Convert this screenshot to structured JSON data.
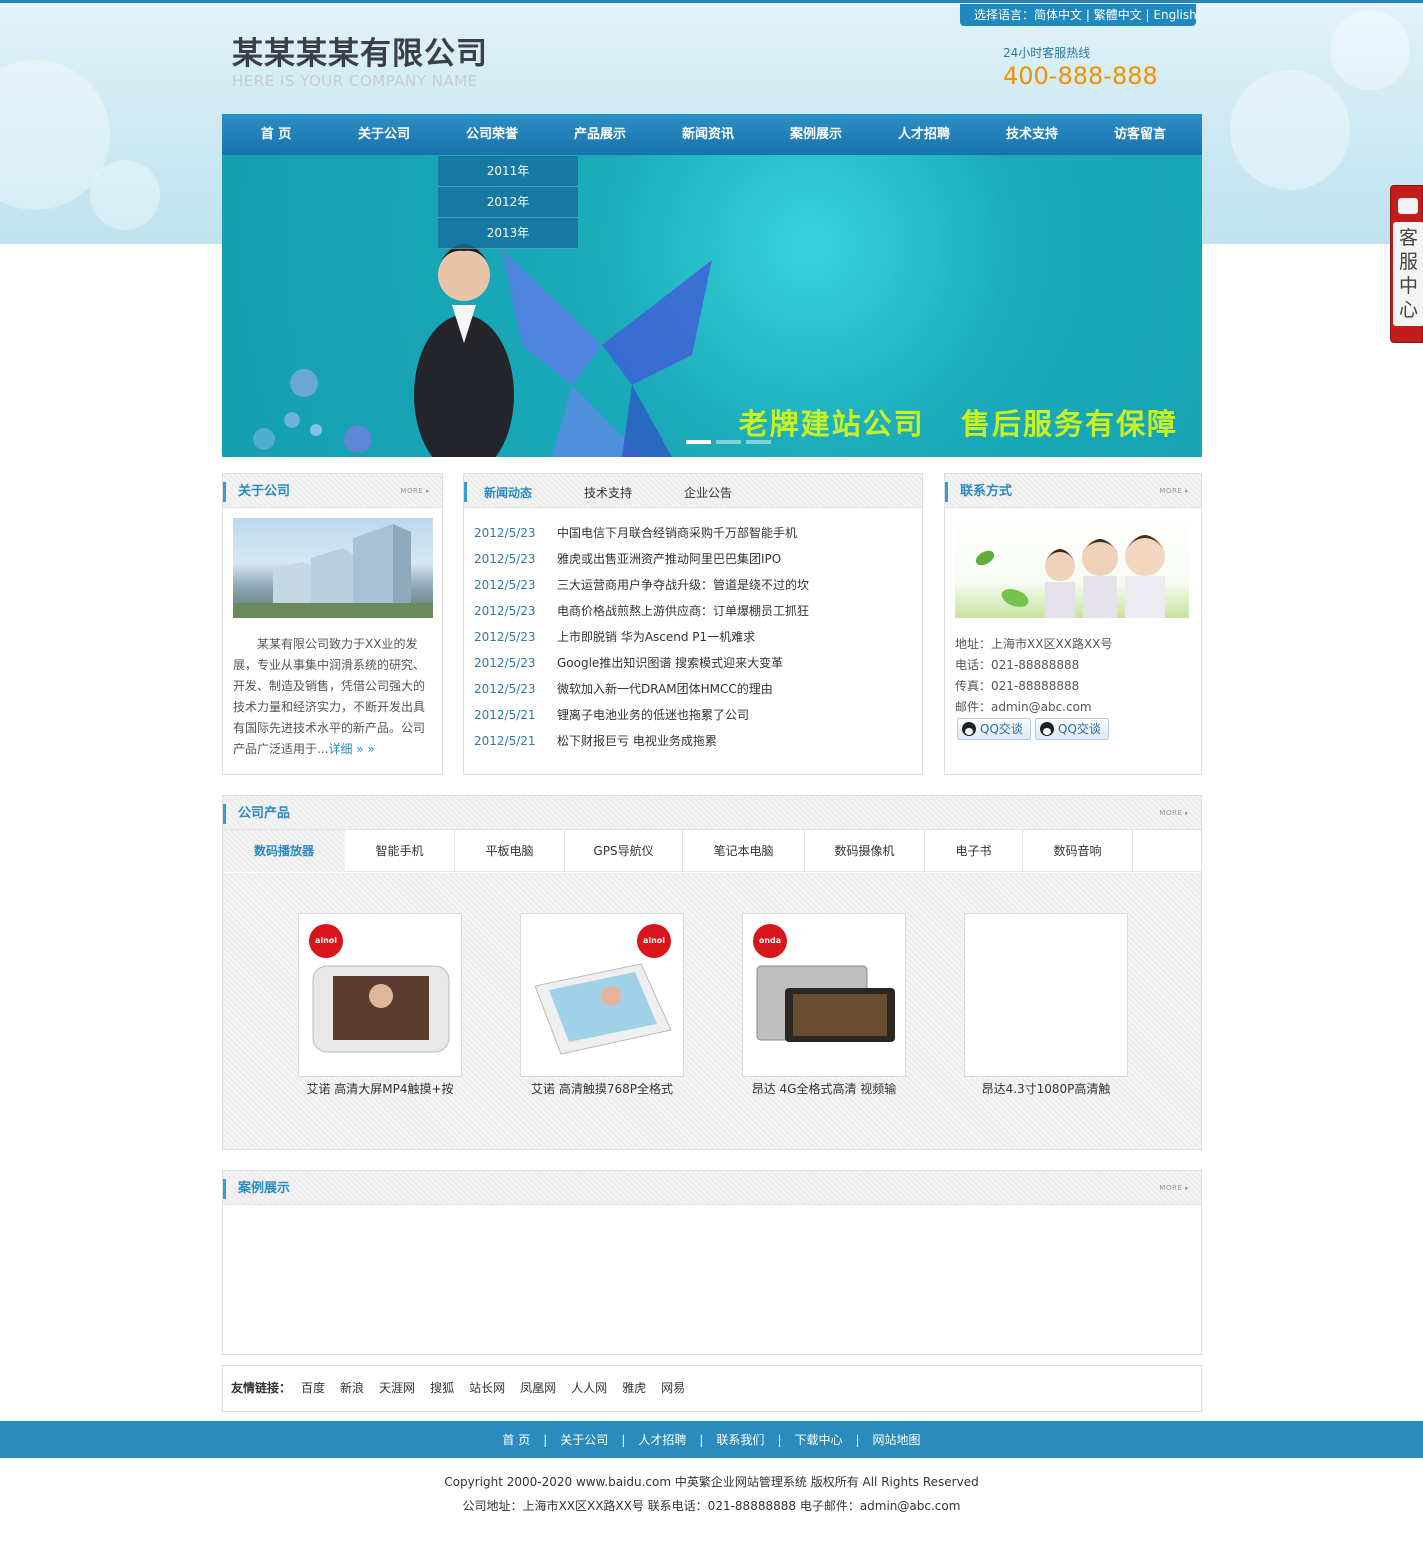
{
  "lang": {
    "label": "选择语言：",
    "items": [
      "简体中文",
      "繁體中文",
      "English"
    ]
  },
  "logo": {
    "cn": "某某某某有限公司",
    "en": "HERE IS YOUR COMPANY NAME"
  },
  "hotline": {
    "label": "24小时客服热线",
    "number": "400-888-888"
  },
  "nav": [
    "首 页",
    "关于公司",
    "公司荣誉",
    "产品展示",
    "新闻资讯",
    "案例展示",
    "人才招聘",
    "技术支持",
    "访客留言"
  ],
  "dropdown": [
    "2011年",
    "2012年",
    "2013年"
  ],
  "banner": {
    "slogan1": "老牌建站公司",
    "slogan2": "售后服务有保障"
  },
  "about": {
    "title": "关于公司",
    "more": "MORE ▸",
    "text": "某某有限公司致力于XX业的发展，专业从事集中润滑系统的研究、开发、制造及销售，凭借公司强大的技术力量和经济实力，不断开发出具有国际先进技术水平的新产品。公司产品广泛适用于...",
    "detail": "详细 » »"
  },
  "news": {
    "tabs": [
      "新闻动态",
      "技术支持",
      "企业公告"
    ],
    "items": [
      {
        "date": "2012/5/23",
        "title": "中国电信下月联合经销商采购千万部智能手机"
      },
      {
        "date": "2012/5/23",
        "title": "雅虎或出售亚洲资产推动阿里巴巴集团IPO"
      },
      {
        "date": "2012/5/23",
        "title": "三大运营商用户争夺战升级：管道是绕不过的坎"
      },
      {
        "date": "2012/5/23",
        "title": "电商价格战煎熬上游供应商：订单爆棚员工抓狂"
      },
      {
        "date": "2012/5/23",
        "title": "上市即脱销 华为Ascend P1一机难求"
      },
      {
        "date": "2012/5/23",
        "title": "Google推出知识图谱 搜索模式迎来大变革"
      },
      {
        "date": "2012/5/23",
        "title": "微软加入新一代DRAM团体HMCC的理由"
      },
      {
        "date": "2012/5/21",
        "title": "锂离子电池业务的低迷也拖累了公司"
      },
      {
        "date": "2012/5/21",
        "title": "松下财报巨亏 电视业务成拖累"
      }
    ]
  },
  "contact": {
    "title": "联系方式",
    "more": "MORE ▸",
    "address": "地址：上海市XX区XX路XX号",
    "phone": "电话：021-88888888",
    "fax": "传真：021-88888888",
    "email": "邮件：admin@abc.com",
    "qq1": "QQ交谈",
    "qq2": "QQ交谈"
  },
  "products": {
    "title": "公司产品",
    "more": "MORE ▸",
    "tabs": [
      "数码播放器",
      "智能手机",
      "平板电脑",
      "GPS导航仪",
      "笔记本电脑",
      "数码摄像机",
      "电子书",
      "数码音响"
    ],
    "items": [
      {
        "caption": "艾诺 高清大屏MP4触摸+按",
        "brand": "ainol"
      },
      {
        "caption": "艾诺 高清触摸768P全格式",
        "brand": "ainol"
      },
      {
        "caption": "昂达 4G全格式高清 视频输",
        "brand": "onda"
      },
      {
        "caption": "昂达4.3寸1080P高清触",
        "brand": ""
      }
    ]
  },
  "cases": {
    "title": "案例展示",
    "more": "MORE ▸"
  },
  "links": {
    "label": "友情链接：",
    "items": [
      "百度",
      "新浪",
      "天涯网",
      "搜狐",
      "站长网",
      "凤凰网",
      "人人网",
      "雅虎",
      "网易"
    ]
  },
  "footer": {
    "nav": [
      "首 页",
      "关于公司",
      "人才招聘",
      "联系我们",
      "下载中心",
      "网站地图"
    ],
    "copyright": "Copyright 2000-2020 www.baidu.com 中英繁企业网站管理系统 版权所有 All Rights Reserved",
    "address": "公司地址：上海市XX区XX路XX号 联系电话：021-88888888 电子邮件：admin@abc.com"
  },
  "kefu": {
    "label": "客服中心"
  },
  "colors": {
    "accent": "#2c8ac3",
    "nav": "#1f82bb",
    "hotline": "#f29100",
    "slogan": "#c9f120",
    "kefu": "#c21c1c"
  }
}
